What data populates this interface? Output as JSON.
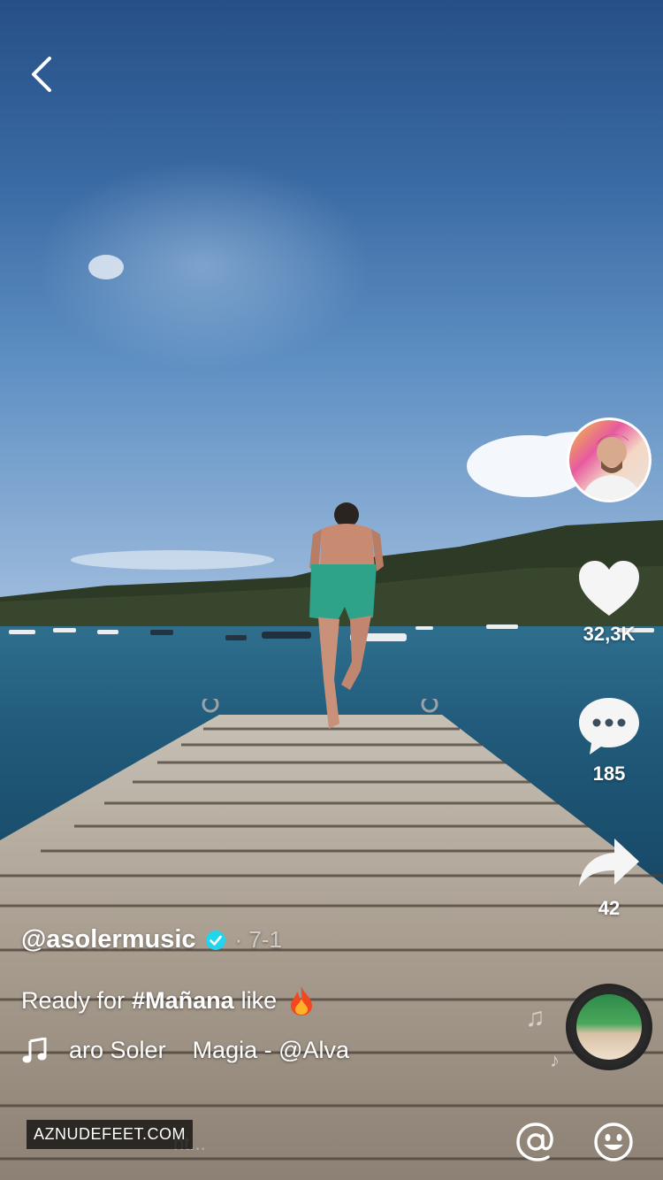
{
  "video": {
    "author": "@asolermusic",
    "date": "· 7-1",
    "description_pre": "Ready for",
    "hashtag": "#Mañana",
    "description_post": "like",
    "music_left": "aro Soler",
    "music_right": "Magia - @Alva"
  },
  "actions": {
    "likes": "32,3K",
    "comments": "185",
    "shares": "42"
  },
  "bottom_bar": {
    "watermark": "AZNUDEFEET.COM",
    "comment_placeholder": "nt..."
  },
  "icons": {
    "back": "back-chevron-icon",
    "like": "heart-icon",
    "comment": "comment-bubble-icon",
    "share": "share-arrow-icon",
    "verified": "verified-badge-icon",
    "music": "music-note-icon",
    "mention": "at-sign-icon",
    "emoji": "smiley-icon"
  },
  "colors": {
    "verified": "#20d5ec",
    "text": "#ffffff"
  }
}
